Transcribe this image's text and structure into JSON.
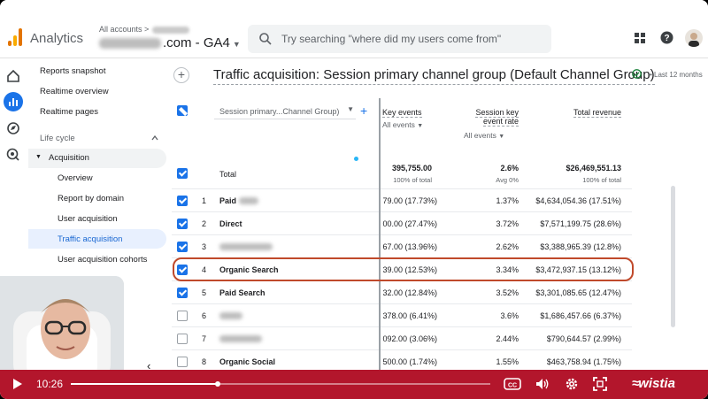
{
  "app": {
    "name": "Analytics",
    "breadcrumb": "All accounts >",
    "property": ".com - GA4",
    "search_placeholder": "Try searching \"where did my users come from\""
  },
  "nav": {
    "top_items": [
      "Reports snapshot",
      "Realtime overview",
      "Realtime pages"
    ],
    "section": "Life cycle",
    "group": "Acquisition",
    "sub_items": [
      "Overview",
      "Report by domain",
      "User acquisition",
      "Traffic acquisition",
      "User acquisition cohorts"
    ],
    "active": "Traffic acquisition"
  },
  "report": {
    "title": "Traffic acquisition: Session primary channel group (Default Channel Group)",
    "date_range": "Last 12 months"
  },
  "table": {
    "dimension": "Session primary...Channel Group)",
    "columns": [
      {
        "label": "Key events",
        "filter": "All events"
      },
      {
        "label": "Session key event rate",
        "filter": "All events"
      },
      {
        "label": "Total revenue",
        "filter": ""
      }
    ],
    "total": {
      "label": "Total",
      "key_events": "395,755.00",
      "key_events_sub": "100% of total",
      "rate": "2.6%",
      "rate_sub": "Avg 0%",
      "revenue": "$26,469,551.13",
      "revenue_sub": "100% of total"
    },
    "rows": [
      {
        "n": "1",
        "label": "Paid",
        "key_events": "79.00 (17.73%)",
        "rate": "1.37%",
        "revenue": "$4,634,054.36 (17.51%)",
        "checked": true
      },
      {
        "n": "2",
        "label": "Direct",
        "key_events": "00.00 (27.47%)",
        "rate": "3.72%",
        "revenue": "$7,571,199.75 (28.6%)",
        "checked": true
      },
      {
        "n": "3",
        "label": "",
        "key_events": "67.00 (13.96%)",
        "rate": "2.62%",
        "revenue": "$3,388,965.39 (12.8%)",
        "checked": true
      },
      {
        "n": "4",
        "label": "Organic Search",
        "key_events": "39.00 (12.53%)",
        "rate": "3.34%",
        "revenue": "$3,472,937.15 (13.12%)",
        "checked": true
      },
      {
        "n": "5",
        "label": "Paid Search",
        "key_events": "32.00 (12.84%)",
        "rate": "3.52%",
        "revenue": "$3,301,085.65 (12.47%)",
        "checked": true
      },
      {
        "n": "6",
        "label": "",
        "key_events": "378.00 (6.41%)",
        "rate": "3.6%",
        "revenue": "$1,686,457.66 (6.37%)",
        "checked": false
      },
      {
        "n": "7",
        "label": "",
        "key_events": "092.00 (3.06%)",
        "rate": "2.44%",
        "revenue": "$790,644.57 (2.99%)",
        "checked": false
      },
      {
        "n": "8",
        "label": "Organic Social",
        "key_events": "500.00 (1.74%)",
        "rate": "1.55%",
        "revenue": "$463,758.94 (1.75%)",
        "checked": false
      }
    ]
  },
  "player": {
    "time": "10:26",
    "progress": 0.35,
    "brand": "wistia"
  },
  "colors": {
    "accent": "#1a73e8",
    "player": "#b3162c",
    "highlight": "#c0492b"
  }
}
